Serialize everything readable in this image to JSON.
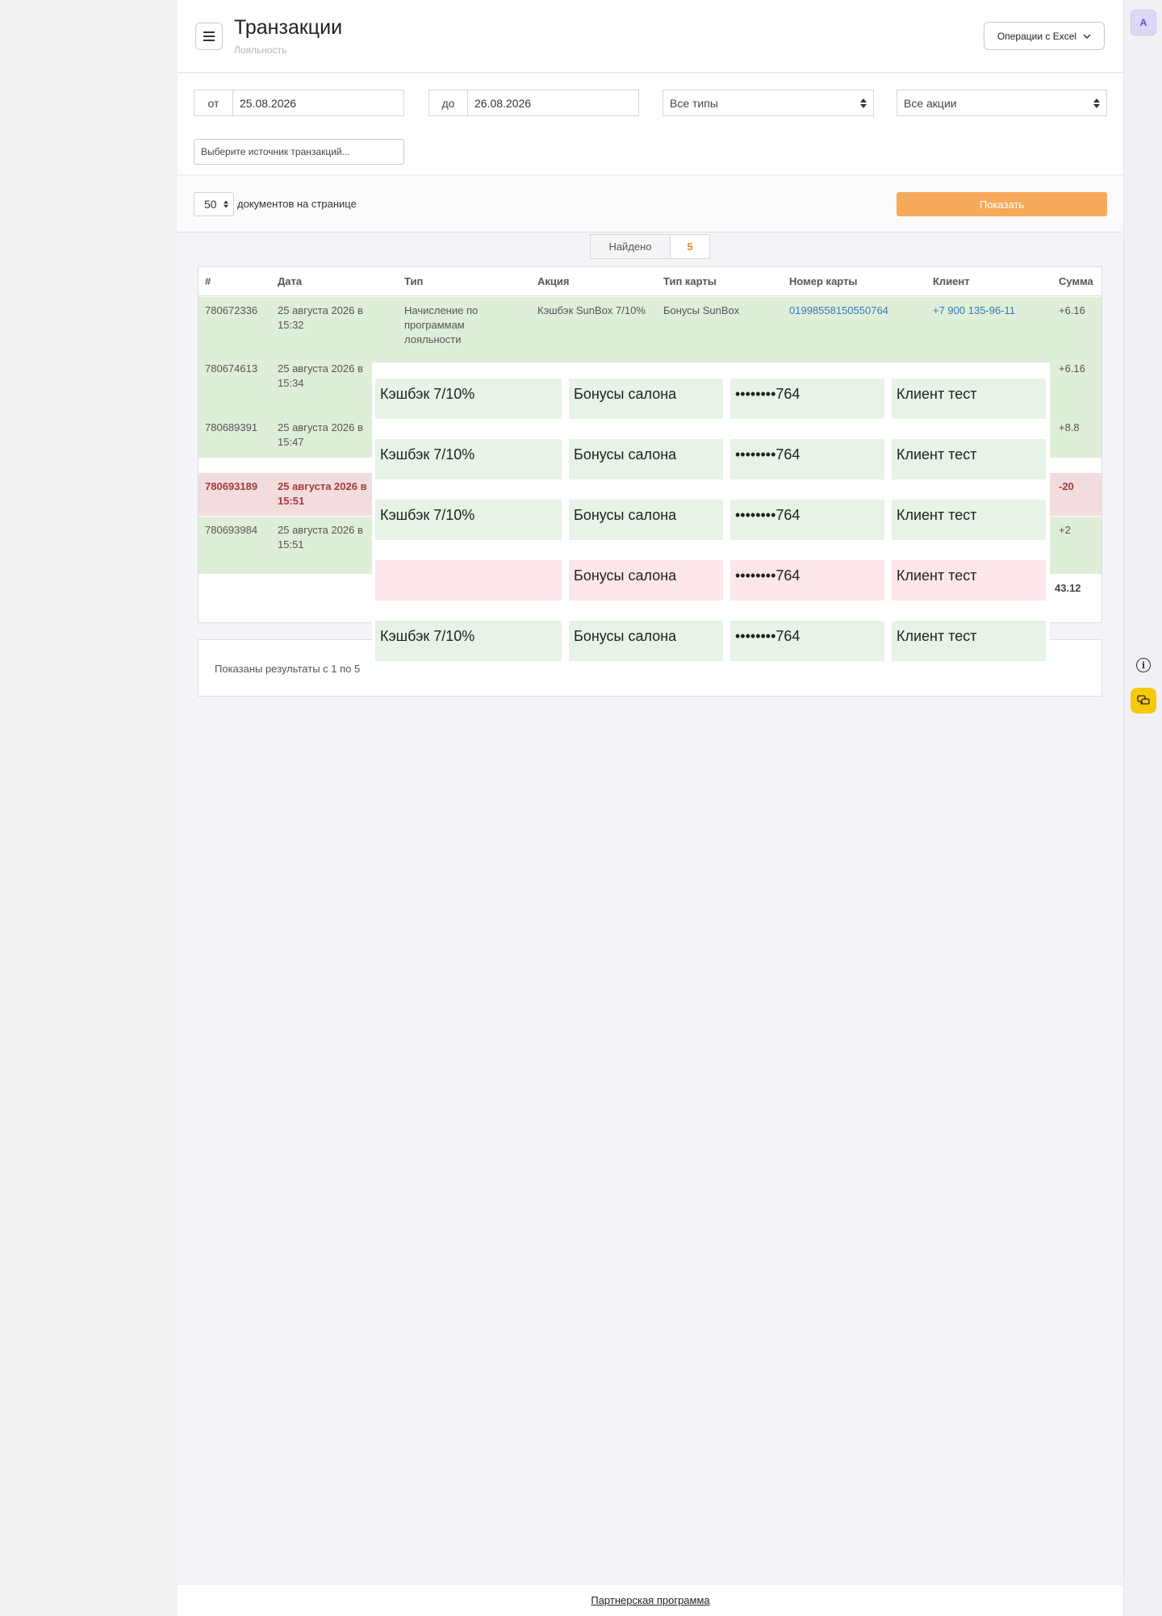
{
  "header": {
    "title": "Транзакции",
    "subtitle": "Лояльность",
    "excel_label": "Операции с Excel",
    "avatar_letter": "A"
  },
  "filters": {
    "from_prefix": "от",
    "from_value": "25.08.2026",
    "to_prefix": "до",
    "to_value": "26.08.2026",
    "type_select": "Все типы",
    "promo_select": "Все акции",
    "source_placeholder": "Выберите источник транзакций..."
  },
  "paging": {
    "per_page_value": "50",
    "per_page_label": "документов на странице",
    "show_button": "Показать"
  },
  "found": {
    "label": "Найдено",
    "count": "5"
  },
  "table": {
    "columns": [
      "#",
      "Дата",
      "Тип",
      "Акция",
      "Тип карты",
      "Номер карты",
      "Клиент",
      "Сумма"
    ],
    "rows": [
      {
        "id": "780672336",
        "date": "25 августа 2026 в 15:32",
        "type": "Начисление по программам лояльности",
        "promo": "Кэшбэк SunBox 7/10%",
        "card_type": "Бонусы SunBox",
        "card_number": "01998558150550764",
        "client": "+7 900 135-96-11",
        "amount": "+6.16",
        "status": "credit"
      },
      {
        "id": "780674613",
        "date": "25 августа 2026 в 15:34",
        "amount": "+6.16",
        "status": "credit"
      },
      {
        "id": "780689391",
        "date": "25 августа 2026 в 15:47",
        "amount": "+8.8",
        "status": "credit"
      },
      {
        "id": "780693189",
        "date": "25 августа 2026 в 15:51",
        "amount": "-20",
        "status": "debit"
      },
      {
        "id": "780693984",
        "date": "25 августа 2026 в 15:51",
        "amount": "+2",
        "status": "credit"
      }
    ],
    "total": "43.12"
  },
  "overlay_rows": [
    {
      "promo": "Кэшбэк 7/10%",
      "card_type": "Бонусы салона",
      "card_number": "••••••••764",
      "client": "Клиент тест",
      "tone": "green"
    },
    {
      "promo": "Кэшбэк 7/10%",
      "card_type": "Бонусы салона",
      "card_number": "••••••••764",
      "client": "Клиент тест",
      "tone": "green"
    },
    {
      "promo": "Кэшбэк 7/10%",
      "card_type": "Бонусы салона",
      "card_number": "••••••••764",
      "client": "Клиент тест",
      "tone": "green"
    },
    {
      "promo": "",
      "card_type": "Бонусы салона",
      "card_number": "••••••••764",
      "client": "Клиент тест",
      "tone": "pink"
    },
    {
      "promo": "Кэшбэк 7/10%",
      "card_type": "Бонусы салона",
      "card_number": "••••••••764",
      "client": "Клиент тест",
      "tone": "green"
    }
  ],
  "results_text": "Показаны результаты с 1 по 5",
  "footer_link": "Партнерская программа",
  "colors": {
    "accent": "#f6a95a",
    "credit_row": "#deeed9",
    "debit_row": "#f3dcde",
    "chat_button": "#f7c90c"
  }
}
